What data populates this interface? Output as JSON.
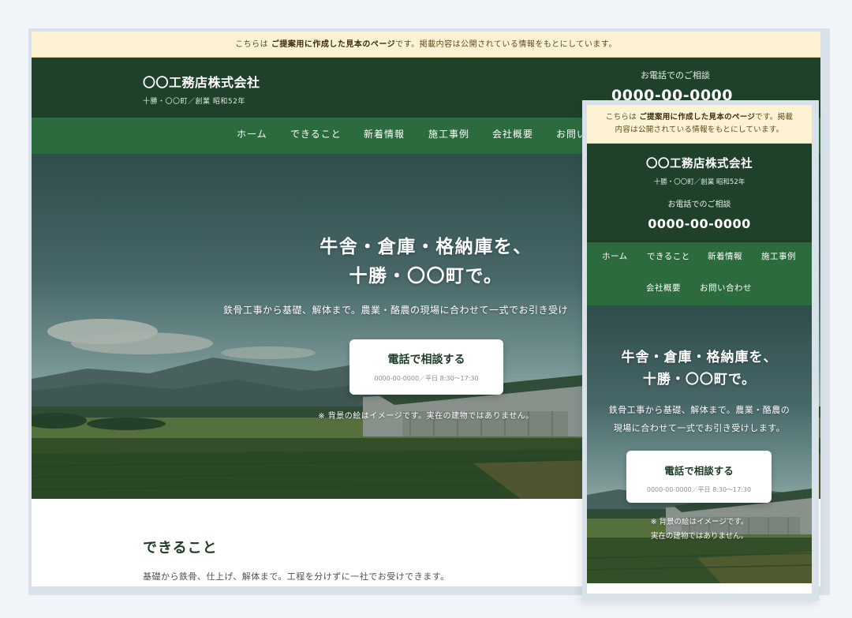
{
  "notice": {
    "prefix": "こちらは ",
    "emphasis": "ご提案用に作成した見本のページ",
    "suffix": "です。掲載内容は公開されている情報をもとにしています。",
    "mobile_line1_suffix": "です。掲載",
    "mobile_line2": "内容は公開されている情報をもとにしています。"
  },
  "header": {
    "company": "〇〇工務店株式会社",
    "subtitle": "十勝・〇〇町／創業 昭和52年",
    "contact_label": "お電話でのご相談",
    "phone": "0000-00-0000"
  },
  "nav": {
    "items": [
      "ホーム",
      "できること",
      "新着情報",
      "施工事例",
      "会社概要",
      "お問い合わせ"
    ],
    "desktop_truncated_last": "お問い"
  },
  "hero": {
    "title_line1": "牛舎・倉庫・格納庫を、",
    "title_line2": "十勝・〇〇町で。",
    "lead": "鉄骨工事から基礎、解体まで。農業・酪農の現場に合わせて一式でお引き受けします。",
    "lead_desktop_visible": "鉄骨工事から基礎、解体まで。農業・酪農の現場に合わせて一式でお引き受け",
    "lead_mobile_line1": "鉄骨工事から基礎、解体まで。農業・酪農の",
    "lead_mobile_line2": "現場に合わせて一式でお引き受けします。",
    "cta_label": "電話で相談する",
    "cta_detail": "0000-00-0000／平日 8:30〜17:30",
    "note": "※ 背景の絵はイメージです。実在の建物ではありません。",
    "note_mobile_line1": "※ 背景の絵はイメージです。",
    "note_mobile_line2": "実在の建物ではありません。"
  },
  "section": {
    "title": "できること",
    "text": "基礎から鉄骨、仕上げ、解体まで。工程を分けずに一社でお受けできます。"
  },
  "colors": {
    "header_bg": "#1f4029",
    "nav_bg": "#2b6b3d",
    "notice_bg": "#fdf3d4",
    "page_bg": "#f1f4f8"
  }
}
